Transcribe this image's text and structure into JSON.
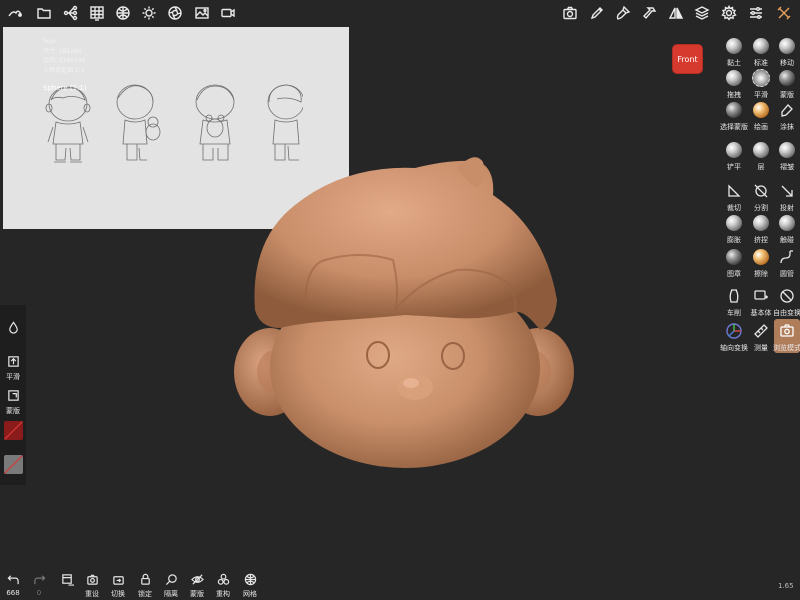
{
  "reference_image": {
    "meta_lines": [
      "Sujo",
      "尺寸: 181x86",
      "比例: 219x146",
      "人物设定图 1:1"
    ],
    "label": "Sphere (1:1)"
  },
  "viewport": {
    "view_label": "Front"
  },
  "right_tools": [
    {
      "label": "黏土",
      "icon": "clay-brush-icon"
    },
    {
      "label": "标准",
      "icon": "standard-brush-icon"
    },
    {
      "label": "移动",
      "icon": "move-brush-icon"
    },
    {
      "label": "拖拽",
      "icon": "drag-brush-icon"
    },
    {
      "label": "平滑",
      "icon": "smooth-brush-icon"
    },
    {
      "label": "蒙版",
      "icon": "mask-brush-icon"
    },
    {
      "label": "选择蒙版",
      "icon": "select-mask-icon"
    },
    {
      "label": "绘画",
      "icon": "paint-brush-icon"
    },
    {
      "label": "涂抹",
      "icon": "smudge-icon"
    },
    {
      "label": "铲平",
      "icon": "flatten-brush-icon"
    },
    {
      "label": "层",
      "icon": "layer-brush-icon"
    },
    {
      "label": "褶皱",
      "icon": "crease-brush-icon"
    },
    {
      "label": "裁切",
      "icon": "trim-icon"
    },
    {
      "label": "分割",
      "icon": "split-icon"
    },
    {
      "label": "投射",
      "icon": "project-icon"
    },
    {
      "label": "膨胀",
      "icon": "inflate-brush-icon"
    },
    {
      "label": "挤捏",
      "icon": "pinch-brush-icon"
    },
    {
      "label": "触碰",
      "icon": "tube-brush-icon"
    },
    {
      "label": "图章",
      "icon": "stamp-brush-icon"
    },
    {
      "label": "擦除",
      "icon": "erase-brush-icon"
    },
    {
      "label": "圆管",
      "icon": "tube-icon"
    },
    {
      "label": "车削",
      "icon": "lathe-icon"
    },
    {
      "label": "基本体",
      "icon": "primitive-icon"
    },
    {
      "label": "自由变换",
      "icon": "transform-icon"
    },
    {
      "label": "轴向变换",
      "icon": "gizmo-icon"
    },
    {
      "label": "测量",
      "icon": "measure-icon"
    },
    {
      "label": "浏览模式",
      "icon": "view-mode-icon"
    }
  ],
  "left_panel": {
    "smooth_label": "平滑",
    "mask_label": "蒙版",
    "colors": {
      "primary": "#8b1a1a",
      "secondary": "#7a7a7a",
      "slash": "#d23a3a"
    }
  },
  "bottom_bar": {
    "undo_count": "668",
    "redo_count": "0",
    "items": [
      "重设",
      "切换",
      "锁定",
      "隔离",
      "蒙版",
      "重构",
      "网格"
    ]
  },
  "version": "1.65",
  "colors": {
    "background": "#262626",
    "model_skin": "#c98f6b",
    "active_tool": "#b07d5b",
    "front_button": "#d63a2f"
  }
}
